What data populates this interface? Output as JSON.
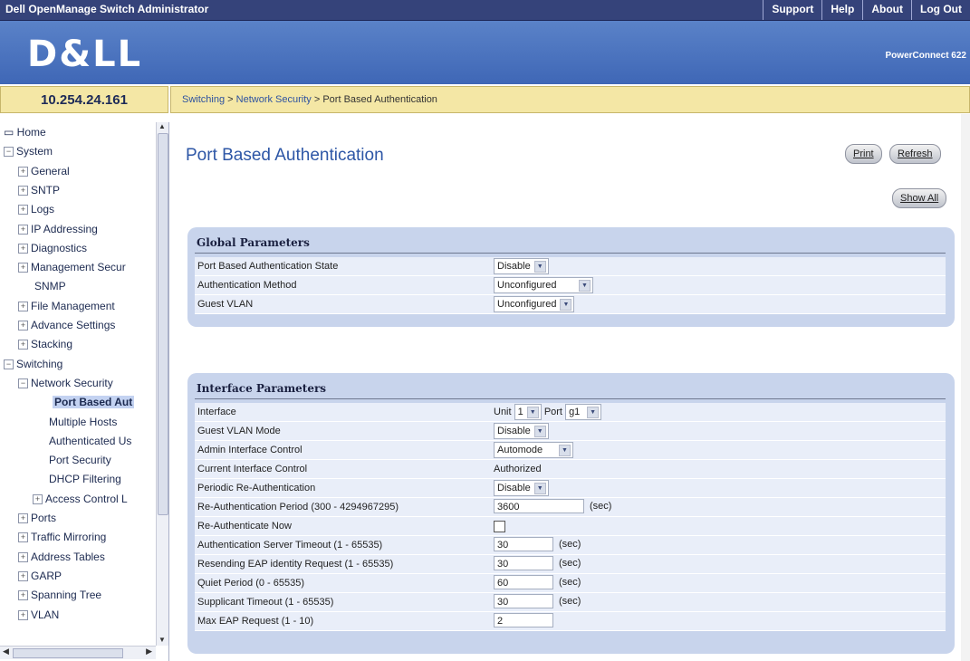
{
  "app": {
    "title": "Dell OpenManage Switch Administrator",
    "brand": "D&LL",
    "product": "PowerConnect 622"
  },
  "toplinks": [
    "Support",
    "Help",
    "About",
    "Log Out"
  ],
  "ip": "10.254.24.161",
  "breadcrumb": {
    "part1": "Switching",
    "part2": "Network Security",
    "part3": "Port Based Authentication",
    "sep": ">"
  },
  "sidebar": {
    "items": [
      {
        "label": "Home",
        "kind": "home"
      },
      {
        "label": "System",
        "kind": "minus"
      },
      {
        "label": "General",
        "kind": "plus"
      },
      {
        "label": "SNTP",
        "kind": "plus"
      },
      {
        "label": "Logs",
        "kind": "plus"
      },
      {
        "label": "IP Addressing",
        "kind": "plus"
      },
      {
        "label": "Diagnostics",
        "kind": "plus"
      },
      {
        "label": "Management Secur",
        "kind": "plus"
      },
      {
        "label": "SNMP",
        "kind": "leaf"
      },
      {
        "label": "File Management",
        "kind": "plus"
      },
      {
        "label": "Advance Settings",
        "kind": "plus"
      },
      {
        "label": "Stacking",
        "kind": "plus"
      },
      {
        "label": "Switching",
        "kind": "minus"
      },
      {
        "label": "Network Security",
        "kind": "minus"
      },
      {
        "label": "Port Based Aut",
        "kind": "selected"
      },
      {
        "label": "Multiple Hosts",
        "kind": "leaf"
      },
      {
        "label": "Authenticated Us",
        "kind": "leaf"
      },
      {
        "label": "Port Security",
        "kind": "leaf"
      },
      {
        "label": "DHCP Filtering",
        "kind": "leaf"
      },
      {
        "label": "Access Control L",
        "kind": "plus"
      },
      {
        "label": "Ports",
        "kind": "plus"
      },
      {
        "label": "Traffic Mirroring",
        "kind": "plus"
      },
      {
        "label": "Address Tables",
        "kind": "plus"
      },
      {
        "label": "GARP",
        "kind": "plus"
      },
      {
        "label": "Spanning Tree",
        "kind": "plus"
      },
      {
        "label": "VLAN",
        "kind": "plus"
      }
    ]
  },
  "page": {
    "title": "Port Based Authentication",
    "print_label": "Print",
    "refresh_label": "Refresh",
    "showall_label": "Show All"
  },
  "global": {
    "title": "Global Parameters",
    "state_label": "Port Based Authentication State",
    "state_value": "Disable",
    "method_label": "Authentication Method",
    "method_value": "Unconfigured",
    "guest_label": "Guest VLAN",
    "guest_value": "Unconfigured"
  },
  "iface": {
    "title": "Interface Parameters",
    "interface_label": "Interface",
    "unit_label": "Unit",
    "unit_value": "1",
    "port_label": "Port",
    "port_value": "g1",
    "guestmode_label": "Guest VLAN Mode",
    "guestmode_value": "Disable",
    "admin_label": "Admin Interface Control",
    "admin_value": "Automode",
    "current_label": "Current Interface Control",
    "current_value": "Authorized",
    "periodic_label": "Periodic Re-Authentication",
    "periodic_value": "Disable",
    "reauth_period_label": "Re-Authentication Period (300 - 4294967295)",
    "reauth_period_value": "3600",
    "reauth_now_label": "Re-Authenticate Now",
    "server_timeout_label": "Authentication Server Timeout (1 - 65535)",
    "server_timeout_value": "30",
    "resend_label": "Resending EAP identity Request (1 - 65535)",
    "resend_value": "30",
    "quiet_label": "Quiet Period (0 - 65535)",
    "quiet_value": "60",
    "supp_label": "Supplicant Timeout (1 - 65535)",
    "supp_value": "30",
    "maxeap_label": "Max EAP Request (1 - 10)",
    "maxeap_value": "2",
    "sec_unit": "(sec)"
  }
}
